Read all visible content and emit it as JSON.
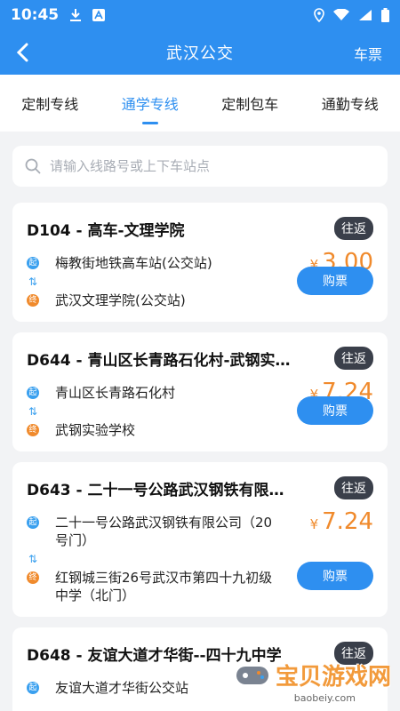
{
  "status": {
    "time": "10:45"
  },
  "appbar": {
    "title": "武汉公交",
    "ticket_label": "车票"
  },
  "tabs": [
    {
      "label": "定制专线"
    },
    {
      "label": "通学专线"
    },
    {
      "label": "定制包车"
    },
    {
      "label": "通勤专线"
    }
  ],
  "search": {
    "placeholder": "请输入线路号或上下车站点"
  },
  "labels": {
    "start_tag": "起",
    "end_tag": "终",
    "trip_tag": "往返",
    "buy": "购票",
    "currency": "¥"
  },
  "routes": [
    {
      "name": "D104 - 高车-文理学院",
      "start": "梅教街地铁高车站(公交站)",
      "end": "武汉文理学院(公交站)",
      "price": "3.00"
    },
    {
      "name": "D644 - 青山区长青路石化村-武钢实…",
      "start": "青山区长青路石化村",
      "end": "武钢实验学校",
      "price": "7.24"
    },
    {
      "name": "D643 - 二十一号公路武汉钢铁有限…",
      "start": "二十一号公路武汉钢铁有限公司（20号门）",
      "end": "红钢城三街26号武汉市第四十九初级中学（北门）",
      "price": "7.24"
    },
    {
      "name": "D648 - 友谊大道才华街--四十九中学",
      "start": "友谊大道才华街公交站",
      "end": "",
      "price": ""
    }
  ],
  "watermark": {
    "text": "宝贝游戏网",
    "sub": "baobeiy.com"
  }
}
